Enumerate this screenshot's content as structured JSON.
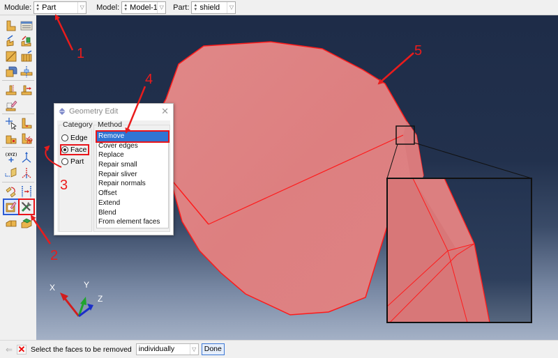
{
  "context_bar": {
    "module_label": "Module:",
    "module_value": "Part",
    "model_label": "Model:",
    "model_value": "Model-1",
    "part_label": "Part:",
    "part_value": "shield"
  },
  "toolbox": {
    "tools": [
      "create-part-icon",
      "part-manager-icon",
      "create-solid-extrude-icon",
      "create-cut-extrude-icon",
      "create-shell-icon",
      "create-wire-icon",
      "create-round-fillet-icon",
      "create-datum-plane-icon",
      "partition-face-icon",
      "create-datum-axis-icon",
      "create-sketch-icon",
      "query-icon",
      "create-reference-point-icon",
      "repair-icon",
      "cut-icon",
      "datum-point-icon",
      "datum-csys-icon",
      "datum-plane-icon",
      "datum-axis-icon",
      "transform-icon",
      "create-partition-icon",
      "edit-feature-icon",
      "geometry-edit-icon",
      "attach-icon",
      "convert-icon"
    ],
    "highlighted_tool": "geometry-edit-icon",
    "active_tool": "edit-feature-icon"
  },
  "dialog": {
    "title": "Geometry Edit",
    "category_title": "Category",
    "categories": [
      {
        "label": "Edge",
        "selected": false
      },
      {
        "label": "Face",
        "selected": true
      },
      {
        "label": "Part",
        "selected": false
      }
    ],
    "method_title": "Method",
    "methods": [
      "Remove",
      "Cover edges",
      "Replace",
      "Repair small",
      "Repair sliver",
      "Repair normals",
      "Offset",
      "Extend",
      "Blend",
      "From element faces"
    ],
    "selected_method": "Remove"
  },
  "triad": {
    "x_label": "X",
    "y_label": "Y",
    "z_label": "Z"
  },
  "prompt": {
    "text": "Select the faces to be removed",
    "selection_mode": "individually",
    "done_label": "Done"
  },
  "annotations": {
    "n1": "1",
    "n2": "2",
    "n3": "3",
    "n4": "4",
    "n5": "5"
  },
  "colors": {
    "part_face": "#e08585",
    "part_edge": "#ff1a1a",
    "annotation": "#ea1c1c",
    "selection": "#2f75d4"
  }
}
